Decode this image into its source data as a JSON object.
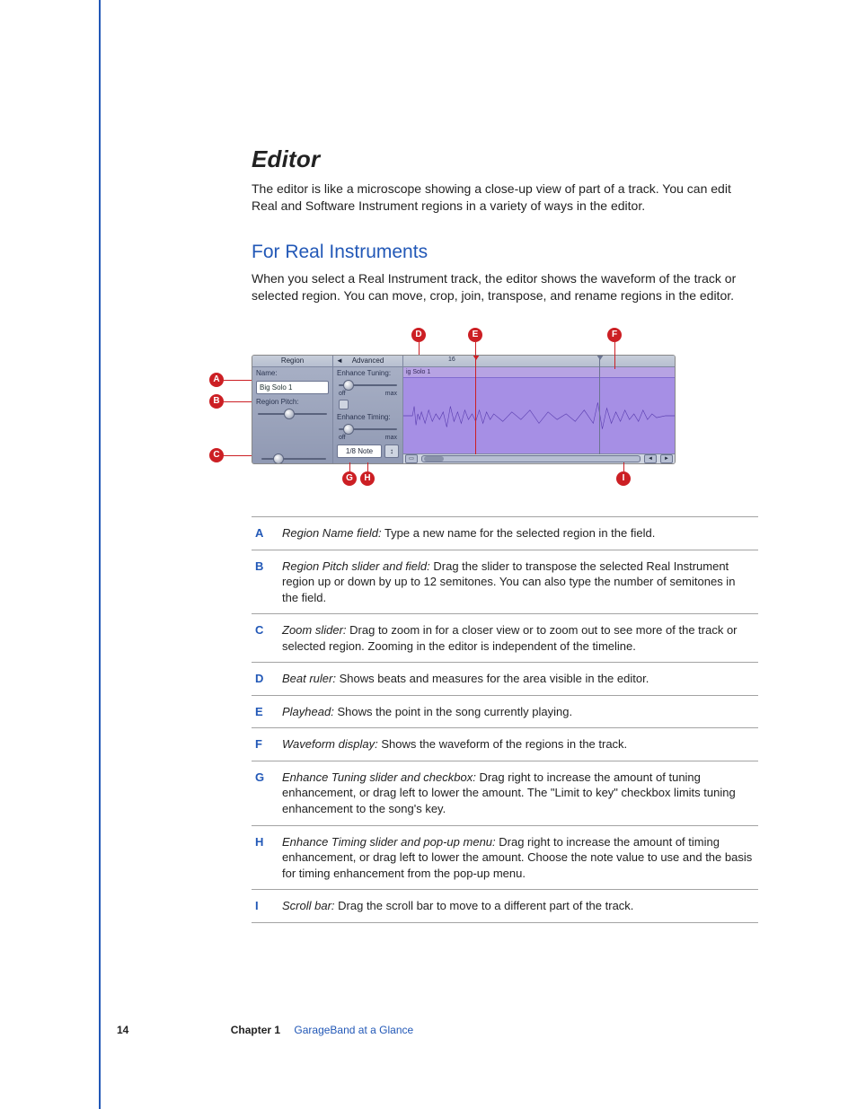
{
  "section": {
    "title": "Editor",
    "intro": "The editor is like a microscope showing a close-up view of part of a track. You can edit Real and Software Instrument regions in a variety of ways in the editor."
  },
  "subsection": {
    "title": "For Real Instruments",
    "intro": "When you select a Real Instrument track, the editor shows the waveform of the track or selected region. You can move, crop, join, transpose, and rename regions in the editor."
  },
  "figure": {
    "panel1_header": "Region",
    "panel2_header": "Advanced",
    "name_label": "Name:",
    "name_value": "Big Solo 1",
    "pitch_label": "Region Pitch:",
    "tuning_label": "Enhance Tuning:",
    "timing_label": "Enhance Timing:",
    "off": "off",
    "max": "max",
    "note_value": "1/8 Note",
    "note_arrows": "↕",
    "scroll_left": "◄",
    "scroll_right": "►",
    "region_clip_name": "ig Solo 1",
    "ruler_mark": "16",
    "collapse": "◄",
    "callout_labels": {
      "A": "A",
      "B": "B",
      "C": "C",
      "D": "D",
      "E": "E",
      "F": "F",
      "G": "G",
      "H": "H",
      "I": "I"
    }
  },
  "callouts": [
    {
      "key": "A",
      "term": "Region Name field:",
      "desc": "Type a new name for the selected region in the field."
    },
    {
      "key": "B",
      "term": "Region Pitch slider and field:",
      "desc": "Drag the slider to transpose the selected Real Instrument region up or down by up to 12 semitones. You can also type the number of semitones in the field."
    },
    {
      "key": "C",
      "term": "Zoom slider:",
      "desc": "Drag to zoom in for a closer view or to zoom out to see more of the track or selected region. Zooming in the editor is independent of the timeline."
    },
    {
      "key": "D",
      "term": "Beat ruler:",
      "desc": "Shows beats and measures for the area visible in the editor."
    },
    {
      "key": "E",
      "term": "Playhead:",
      "desc": "Shows the point in the song currently playing."
    },
    {
      "key": "F",
      "term": "Waveform display:",
      "desc": "Shows the waveform of the regions in the track."
    },
    {
      "key": "G",
      "term": "Enhance Tuning slider and checkbox:",
      "desc": "Drag right to increase the amount of tuning enhancement, or drag left to lower the amount. The \"Limit to key\" checkbox limits tuning enhancement to the song's key."
    },
    {
      "key": "H",
      "term": "Enhance Timing slider and pop-up menu:",
      "desc": "Drag right to increase the amount of timing enhancement, or drag left to lower the amount. Choose the note value to use and the basis for timing enhancement from the pop-up menu."
    },
    {
      "key": "I",
      "term": "Scroll bar:",
      "desc": "Drag the scroll bar to move to a different part of the track."
    }
  ],
  "footer": {
    "page": "14",
    "chapter_label": "Chapter 1",
    "chapter_name": "GarageBand at a Glance"
  }
}
